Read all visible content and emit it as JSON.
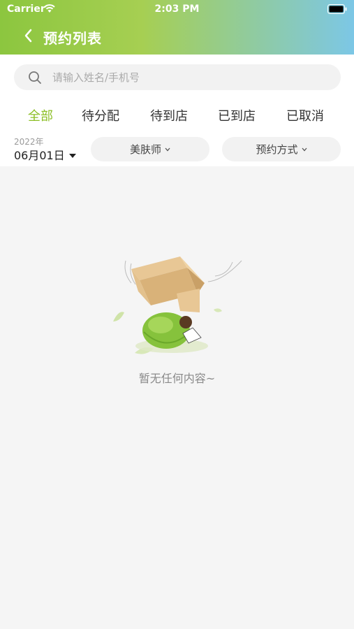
{
  "status_bar": {
    "carrier": "Carrier",
    "time": "2:03 PM"
  },
  "nav": {
    "title": "预约列表",
    "back_icon": "chevron-left-icon"
  },
  "search": {
    "placeholder": "请输入姓名/手机号",
    "value": "",
    "icon": "search-icon"
  },
  "tabs": [
    {
      "label": "全部",
      "active": true
    },
    {
      "label": "待分配",
      "active": false
    },
    {
      "label": "待到店",
      "active": false
    },
    {
      "label": "已到店",
      "active": false
    },
    {
      "label": "已取消",
      "active": false
    }
  ],
  "filters": {
    "date_year": "2022年",
    "date_day": "06月01日",
    "beautician_label": "美肤师",
    "method_label": "预约方式"
  },
  "empty_state": {
    "message": "暂无任何内容~",
    "illustration": "empty-box-illustration"
  },
  "colors": {
    "accent": "#8cbf26",
    "header_gradient_start": "#8cc63f",
    "header_gradient_end": "#7cc7e6",
    "background": "#f5f5f5"
  }
}
